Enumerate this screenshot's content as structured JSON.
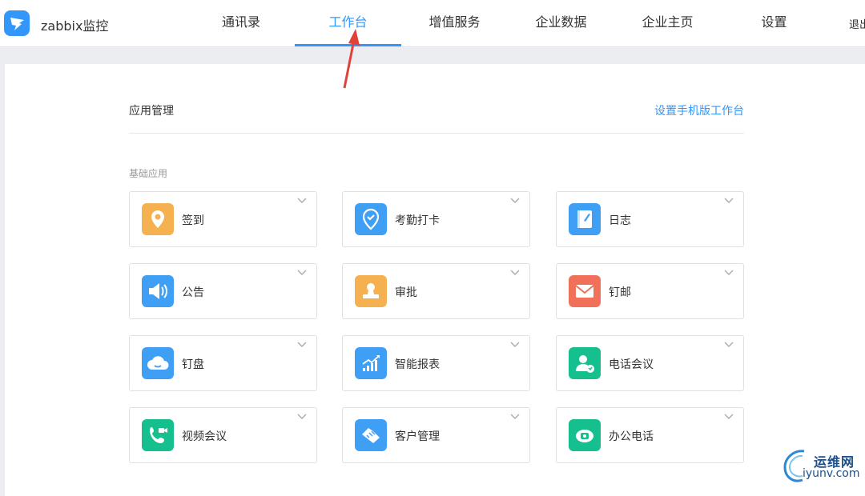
{
  "header": {
    "org_name": "zabbix监控",
    "nav": [
      "通讯录",
      "工作台",
      "增值服务",
      "企业数据",
      "企业主页",
      "设置"
    ],
    "active_nav": "工作台",
    "logout_label": "退出"
  },
  "main": {
    "section_title": "应用管理",
    "mobile_link": "设置手机版工作台",
    "subhead": "基础应用",
    "apps": [
      {
        "label": "签到",
        "icon": "location-pin-icon",
        "color": "#f5b04f"
      },
      {
        "label": "考勤打卡",
        "icon": "checkin-pin-icon",
        "color": "#3f9ff5"
      },
      {
        "label": "日志",
        "icon": "notebook-icon",
        "color": "#3f9ff5"
      },
      {
        "label": "公告",
        "icon": "megaphone-icon",
        "color": "#3f9ff5"
      },
      {
        "label": "审批",
        "icon": "stamp-icon",
        "color": "#f5b04f"
      },
      {
        "label": "钉邮",
        "icon": "mail-icon",
        "color": "#f1705a"
      },
      {
        "label": "钉盘",
        "icon": "cloud-icon",
        "color": "#3f9ff5"
      },
      {
        "label": "智能报表",
        "icon": "chart-icon",
        "color": "#3f9ff5"
      },
      {
        "label": "电话会议",
        "icon": "phone-conference-icon",
        "color": "#16c08e"
      },
      {
        "label": "视频会议",
        "icon": "video-call-icon",
        "color": "#16c08e"
      },
      {
        "label": "客户管理",
        "icon": "handshake-icon",
        "color": "#3f9ff5"
      },
      {
        "label": "办公电话",
        "icon": "office-phone-icon",
        "color": "#16c08e"
      }
    ]
  },
  "watermark": {
    "cn": "运维网",
    "en": "iyunv.com"
  },
  "colors": {
    "accent": "#3296fa",
    "arrow": "#e0413a"
  }
}
